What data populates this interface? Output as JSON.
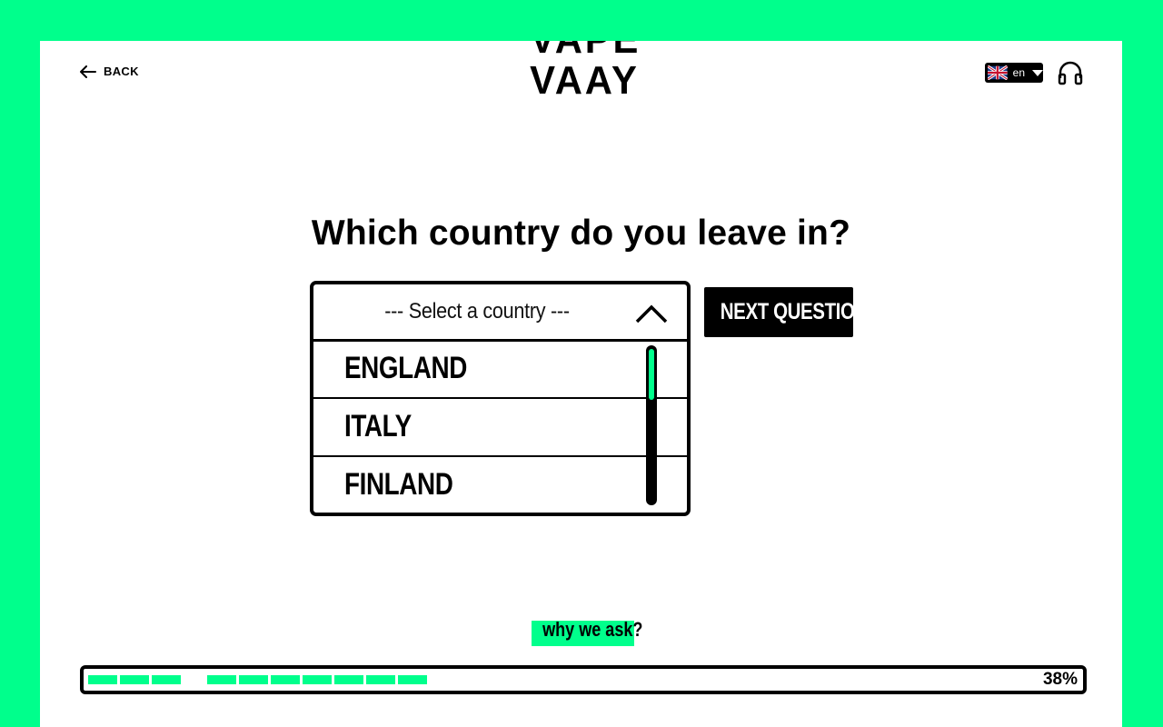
{
  "header": {
    "back_label": "BACK",
    "logo_line1": "VAPE",
    "logo_line2": "VAAY",
    "language_code": "en"
  },
  "question": {
    "text": "Which country do you leave in?"
  },
  "country_select": {
    "placeholder": "--- Select a country ---",
    "options": [
      "ENGLAND",
      "ITALY",
      "FINLAND"
    ],
    "expanded": true
  },
  "next_button_label": "NEXT QUESTION",
  "why_label": "why we ask?",
  "progress": {
    "percent": 38,
    "label": "38%"
  },
  "colors": {
    "accent": "#00ff8c",
    "ink": "#000000",
    "panel": "#ffffff"
  },
  "icons": [
    "arrow-left-icon",
    "uk-flag-icon",
    "caret-down-icon",
    "headphones-icon",
    "chevron-up-icon"
  ]
}
